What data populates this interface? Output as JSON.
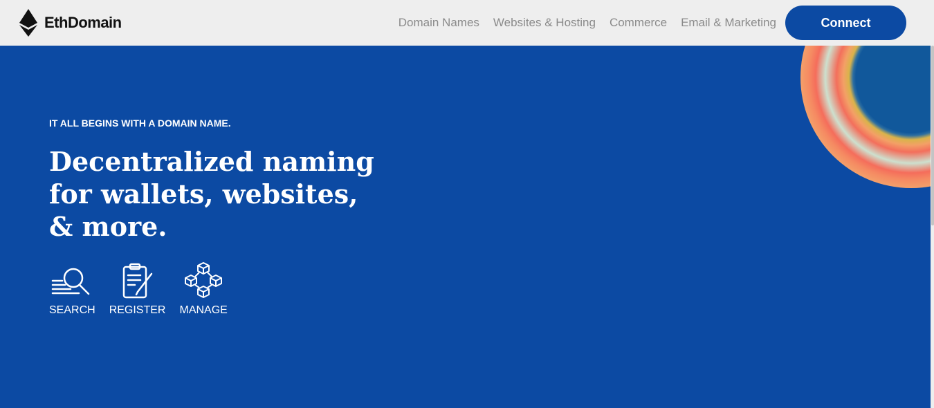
{
  "header": {
    "brand": "EthDomain",
    "nav": [
      "Domain Names",
      "Websites & Hosting",
      "Commerce",
      "Email & Marketing"
    ],
    "connect_label": "Connect"
  },
  "hero": {
    "eyebrow": "IT ALL BEGINS WITH A DOMAIN NAME.",
    "headline": "Decentralized naming for wallets, websites, & more.",
    "features": [
      {
        "label": "SEARCH",
        "icon": "search-icon"
      },
      {
        "label": "REGISTER",
        "icon": "register-icon"
      },
      {
        "label": "MANAGE",
        "icon": "manage-icon"
      }
    ]
  },
  "colors": {
    "brand_blue": "#0c4aa3",
    "header_bg": "#eeeeee",
    "nav_text": "#8a8a8a"
  }
}
